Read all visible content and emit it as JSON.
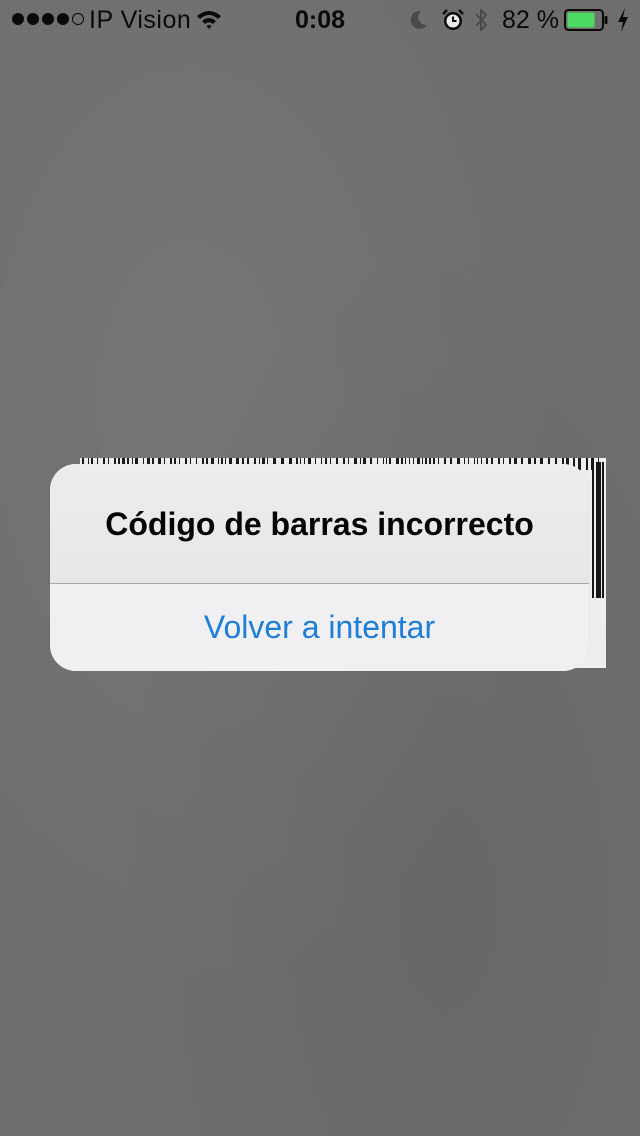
{
  "status_bar": {
    "signal_strength": 4,
    "signal_max": 5,
    "carrier": "IP Vision",
    "wifi_icon": "wifi-icon",
    "time": "0:08",
    "do_not_disturb_icon": "moon-icon",
    "alarm_icon": "alarm-clock-icon",
    "bluetooth_icon": "bluetooth-icon",
    "battery_percent_label": "82 %",
    "battery_level": 0.82,
    "battery_color": "#4cd964",
    "charging_icon": "bolt-icon"
  },
  "alert": {
    "title": "Código de barras incorrecto",
    "button_label": "Volver a intentar",
    "button_color": "#1d7ed8"
  },
  "background": {
    "color": "#6f6e6c"
  }
}
